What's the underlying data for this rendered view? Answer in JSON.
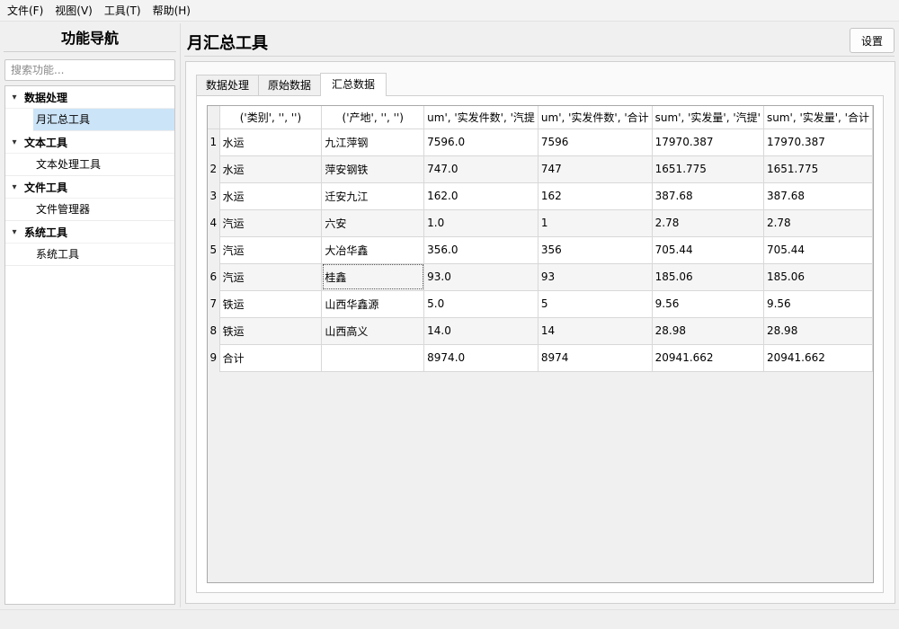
{
  "menubar": {
    "items": [
      "文件(F)",
      "视图(V)",
      "工具(T)",
      "帮助(H)"
    ]
  },
  "nav": {
    "title": "功能导航",
    "search_placeholder": "搜索功能...",
    "groups": [
      {
        "label": "数据处理",
        "items": [
          "月汇总工具"
        ]
      },
      {
        "label": "文本工具",
        "items": [
          "文本处理工具"
        ]
      },
      {
        "label": "文件工具",
        "items": [
          "文件管理器"
        ]
      },
      {
        "label": "系统工具",
        "items": [
          "系统工具"
        ]
      }
    ],
    "selected": "月汇总工具",
    "expand_glyph": "▾"
  },
  "page": {
    "title": "月汇总工具",
    "settings_label": "设置"
  },
  "tabs": [
    "数据处理",
    "原始数据",
    "汇总数据"
  ],
  "active_tab": "汇总数据",
  "table": {
    "headers": [
      "('类别', '', '')",
      "('产地', '', '')",
      "um', '实发件数', '汽提",
      "um', '实发件数', '合计",
      "sum', '实发量', '汽提'",
      "sum', '实发量', '合计"
    ],
    "rows": [
      {
        "num": "1",
        "cells": [
          "水运",
          "九江萍钢",
          "7596.0",
          "7596",
          "17970.387",
          "17970.387"
        ]
      },
      {
        "num": "2",
        "cells": [
          "水运",
          "萍安钢铁",
          "747.0",
          "747",
          "1651.775",
          "1651.775"
        ]
      },
      {
        "num": "3",
        "cells": [
          "水运",
          "迁安九江",
          "162.0",
          "162",
          "387.68",
          "387.68"
        ]
      },
      {
        "num": "4",
        "cells": [
          "汽运",
          "六安",
          "1.0",
          "1",
          "2.78",
          "2.78"
        ]
      },
      {
        "num": "5",
        "cells": [
          "汽运",
          "大冶华鑫",
          "356.0",
          "356",
          "705.44",
          "705.44"
        ]
      },
      {
        "num": "6",
        "cells": [
          "汽运",
          "桂鑫",
          "93.0",
          "93",
          "185.06",
          "185.06"
        ]
      },
      {
        "num": "7",
        "cells": [
          "铁运",
          "山西华鑫源",
          "5.0",
          "5",
          "9.56",
          "9.56"
        ]
      },
      {
        "num": "8",
        "cells": [
          "铁运",
          "山西高义",
          "14.0",
          "14",
          "28.98",
          "28.98"
        ]
      },
      {
        "num": "9",
        "cells": [
          "合计",
          "",
          "8974.0",
          "8974",
          "20941.662",
          "20941.662"
        ]
      }
    ],
    "focused_cell": {
      "row": 5,
      "col": 1
    }
  }
}
